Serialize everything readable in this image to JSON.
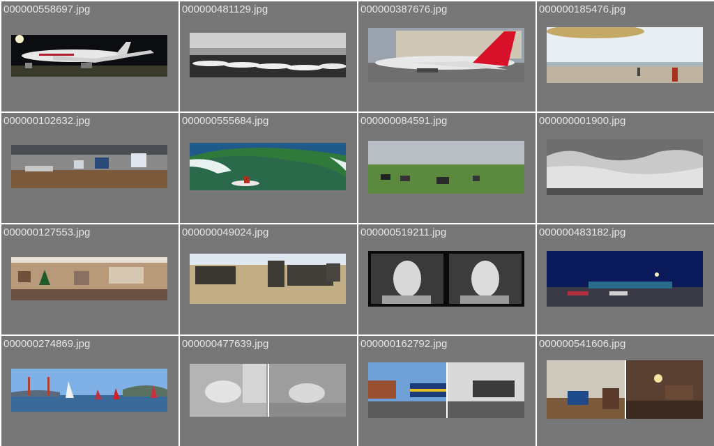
{
  "grid": {
    "tiles": [
      {
        "filename": "000000558697.jpg",
        "thumb": "airliner-night"
      },
      {
        "filename": "000000481129.jpg",
        "thumb": "airplanes-row-bw"
      },
      {
        "filename": "000000387676.jpg",
        "thumb": "airliner-red-tail"
      },
      {
        "filename": "000000185476.jpg",
        "thumb": "beach-kite"
      },
      {
        "filename": "000000102632.jpg",
        "thumb": "office-desks"
      },
      {
        "filename": "000000555684.jpg",
        "thumb": "surfer-wave"
      },
      {
        "filename": "000000084591.jpg",
        "thumb": "zebras-plain"
      },
      {
        "filename": "000000001900.jpg",
        "thumb": "waves-bw"
      },
      {
        "filename": "000000127553.jpg",
        "thumb": "living-room-panorama"
      },
      {
        "filename": "000000049024.jpg",
        "thumb": "zebras-herd"
      },
      {
        "filename": "000000519211.jpg",
        "thumb": "phone-women-bw"
      },
      {
        "filename": "000000483182.jpg",
        "thumb": "airport-night"
      },
      {
        "filename": "000000274869.jpg",
        "thumb": "sailboats-bridge"
      },
      {
        "filename": "000000477639.jpg",
        "thumb": "sheep-bw"
      },
      {
        "filename": "000000162792.jpg",
        "thumb": "train-station"
      },
      {
        "filename": "000000541606.jpg",
        "thumb": "room-interior"
      }
    ]
  }
}
